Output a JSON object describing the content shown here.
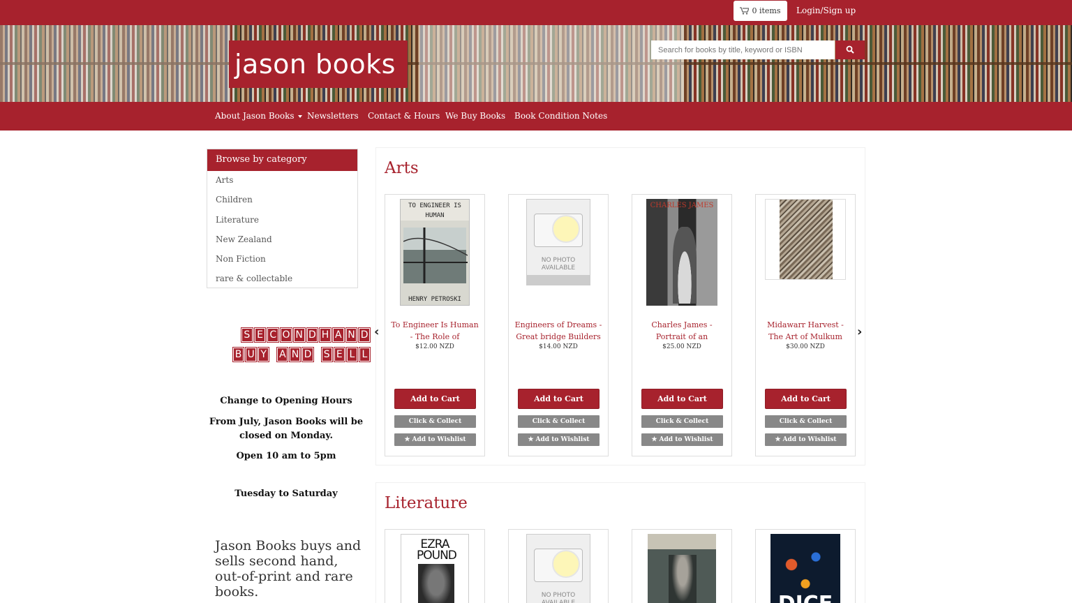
{
  "header": {
    "cart_label": "0 items",
    "login_label": "Login/Sign up",
    "logo": "jason books",
    "search_placeholder": "Search for books by title, keyword or ISBN"
  },
  "nav": {
    "items": [
      "About Jason Books",
      "Newsletters",
      "Contact & Hours",
      "We Buy Books",
      "Book Condition Notes"
    ]
  },
  "sidebar": {
    "heading": "Browse by category",
    "categories": [
      "Arts",
      "Children",
      "Literature",
      "New Zealand",
      "Non Fiction",
      "rare & collectable"
    ],
    "sign_line1": "SECONDHAND",
    "sign_line2": "BUY AND SELL",
    "notice_title": "Change to Opening Hours",
    "notice_body": "From July, Jason Books will be closed on Monday.",
    "notice_hours": "Open 10 am to 5pm",
    "notice_days": "Tuesday to Saturday",
    "intro": "Jason Books buys and sells second hand, out-of-print and rare books."
  },
  "sections": [
    {
      "title": "Arts",
      "books": [
        {
          "title": "To Engineer Is Human - The Role of",
          "price": "$12.00 NZD",
          "cover_top": "TO ENGINEER IS HUMAN",
          "cover_author": "HENRY PETROSKI"
        },
        {
          "title": "Engineers of Dreams - Great bridge Builders",
          "price": "$14.00 NZD",
          "no_photo": "NO PHOTO AVAILABLE"
        },
        {
          "title": "Charles James - Portrait of an",
          "price": "$25.00 NZD",
          "cover_top": "CHARLES JAMES"
        },
        {
          "title": "Midawarr Harvest - The Art of Mulkum",
          "price": "$30.00 NZD"
        }
      ]
    },
    {
      "title": "Literature",
      "books": [
        {
          "cover_top": "EZRA POUND"
        },
        {
          "no_photo": "NO PHOTO AVAILABLE"
        },
        {},
        {
          "cover_bottom": "DICE"
        }
      ]
    }
  ],
  "buttons": {
    "add_to_cart": "Add to Cart",
    "click_collect": "Click & Collect",
    "add_wishlist": "Add to Wishlist"
  },
  "colors": {
    "brand": "#a7222d",
    "button_grey": "#888888"
  }
}
